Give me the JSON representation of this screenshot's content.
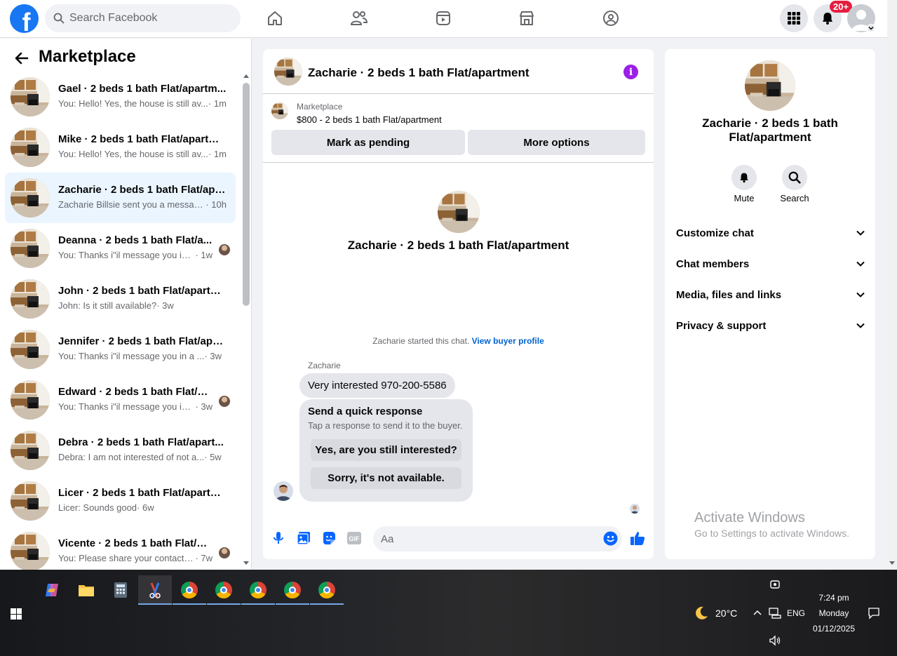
{
  "topbar": {
    "logo": "f",
    "search_placeholder": "Search Facebook",
    "nav_icons": [
      "home-icon",
      "friends-icon",
      "video-icon",
      "marketplace-icon",
      "groups-icon"
    ],
    "notification_badge": "20+"
  },
  "sidebar": {
    "title": "Marketplace",
    "chats": [
      {
        "name": "Gael · 2 beds 1 bath Flat/apartm...",
        "preview": "You: Hello! Yes, the house is still av...",
        "time": " · 1m",
        "seen": false,
        "active": false
      },
      {
        "name": "Mike · 2 beds 1 bath Flat/apartm...",
        "preview": "You: Hello! Yes, the house is still av...",
        "time": " · 1m",
        "seen": false,
        "active": false
      },
      {
        "name": "Zacharie · 2 beds 1 bath Flat/apa...",
        "preview": "Zacharie Billsie sent you a messag...",
        "time": " · 10h",
        "seen": false,
        "active": true
      },
      {
        "name": "Deanna · 2 beds 1 bath Flat/a...",
        "preview": "You: Thanks i\"il message you in ...",
        "time": " · 1w",
        "seen": true,
        "active": false
      },
      {
        "name": "John · 2 beds 1 bath Flat/apartm...",
        "preview": "John: Is it still available?",
        "time": " · 3w",
        "seen": false,
        "active": false
      },
      {
        "name": "Jennifer · 2 beds 1 bath Flat/apa...",
        "preview": "You: Thanks i\"il message you in a ...",
        "time": " · 3w",
        "seen": false,
        "active": false
      },
      {
        "name": "Edward · 2 beds 1 bath Flat/ap...",
        "preview": "You: Thanks i\"il message you in ...",
        "time": " · 3w",
        "seen": true,
        "active": false
      },
      {
        "name": "Debra · 2 beds 1 bath Flat/apart...",
        "preview": "Debra: I am not interested of not a...",
        "time": " · 5w",
        "seen": false,
        "active": false
      },
      {
        "name": "Licer · 2 beds 1 bath Flat/apartm...",
        "preview": "Licer: Sounds good",
        "time": " · 6w",
        "seen": false,
        "active": false
      },
      {
        "name": "Vicente · 2 beds 1 bath Flat/ap...",
        "preview": "You: Please share your contact n...",
        "time": " · 7w",
        "seen": true,
        "active": false
      }
    ]
  },
  "chat": {
    "header_title": "Zacharie · 2 beds 1 bath Flat/apartment",
    "listing_label": "Marketplace",
    "listing_price": "$800 - 2 beds 1 bath Flat/apartment",
    "mark_pending": "Mark as pending",
    "more_options": "More options",
    "intro_title": "Zacharie · 2 beds 1 bath Flat/apartment",
    "started_text": "Zacharie started this chat.",
    "view_buyer": "View buyer profile",
    "sender": "Zacharie",
    "message": "Very interested 970-200-5586",
    "quick_title": "Send a quick response",
    "quick_sub": "Tap a response to send it to the buyer.",
    "quick_1": "Yes, are you still interested?",
    "quick_2": "Sorry, it's not available.",
    "input_placeholder": "Aa"
  },
  "info_panel": {
    "title": "Zacharie · 2 beds 1 bath Flat/apartment",
    "mute": "Mute",
    "search": "Search",
    "sections": [
      "Customize chat",
      "Chat members",
      "Media, files and links",
      "Privacy & support"
    ]
  },
  "watermark": {
    "line1": "Activate Windows",
    "line2": "Go to Settings to activate Windows."
  },
  "taskbar": {
    "weather": "20°C",
    "lang": "ENG",
    "time": "7:24 pm",
    "day": "Monday",
    "date": "01/12/2025"
  },
  "colors": {
    "brand": "#1877f2",
    "active_chat": "#ebf5ff",
    "info_icon": "#9b1fe8",
    "link": "#0064d1",
    "badge": "#e41e3f"
  }
}
